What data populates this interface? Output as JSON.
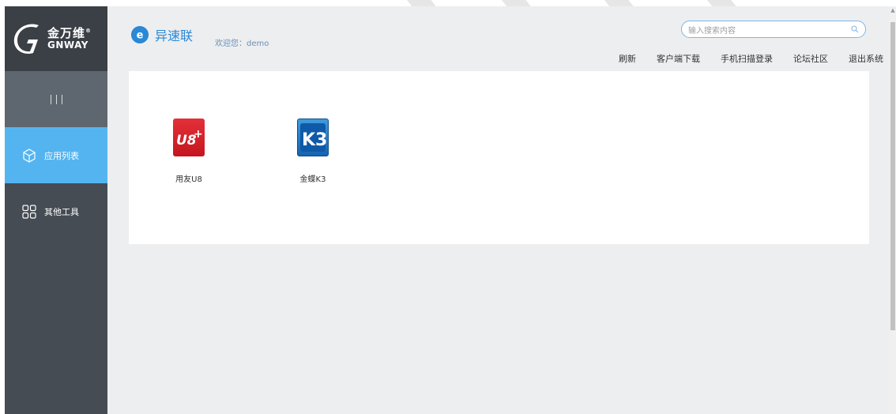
{
  "logo": {
    "cn": "金万维",
    "en": "GNWAY",
    "mark": "®"
  },
  "sidebar": {
    "items": [
      {
        "label": "应用列表",
        "icon": "cube-icon",
        "active": true
      },
      {
        "label": "其他工具",
        "icon": "grid-icon",
        "active": false
      }
    ]
  },
  "header": {
    "brand": "异速联",
    "welcome": "欢迎您：demo",
    "search_placeholder": "输入搜索内容",
    "links": [
      "刷新",
      "客户端下载",
      "手机扫描登录",
      "论坛社区",
      "退出系统"
    ]
  },
  "apps": [
    {
      "label": "用友U8",
      "icon": "u8-app-icon",
      "badge": "U8",
      "plus": "+"
    },
    {
      "label": "金蝶K3",
      "icon": "k3-app-icon",
      "badge": "K3"
    }
  ],
  "colors": {
    "sidebar": "#454c53",
    "active": "#54b4f0",
    "brand": "#2a88d5",
    "background": "#edeef0"
  }
}
